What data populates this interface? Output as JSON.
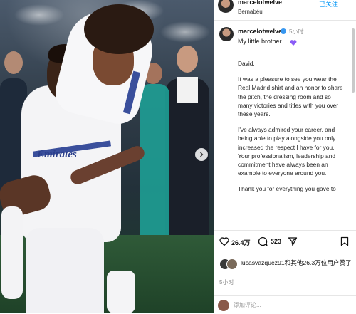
{
  "post": {
    "header": {
      "username": "marcelotwelve",
      "location": "Bernabéu",
      "follow_label": "已关注"
    },
    "caption": {
      "username": "marcelotwelve",
      "time": "5小时",
      "first_line": "My little brother...",
      "paragraphs": [
        "David,",
        "It was a pleasure to see you wear the Real Madrid shirt and an honor to share the pitch, the dressing room and so many victories and titles with you over these years.",
        "I've always admired your career, and being able to play alongside you only increased the respect I have for you. Your professionalism, leadership and commitment have always been an example to everyone around you.",
        "Thank you for everything you gave to"
      ]
    },
    "actions": {
      "likes_count": "26.4万",
      "comments_count": "523"
    },
    "liked_by": {
      "text": "lucasvazquez91和其他26.3万位用户赞了",
      "time": "5小时"
    },
    "comment_input": {
      "placeholder": "添加评论..."
    }
  },
  "photo": {
    "sponsor_text": "Emirates",
    "jersey_color": "#f4f4f6",
    "stripe_color": "#3a4f9c"
  },
  "colors": {
    "accent": "#0095f6",
    "verified": "#3897f0",
    "heart_emoji": "#8a5cf6"
  },
  "icons": [
    "heart-icon",
    "comment-icon",
    "share-icon",
    "bookmark-icon",
    "next-slide-icon",
    "verified-icon"
  ]
}
